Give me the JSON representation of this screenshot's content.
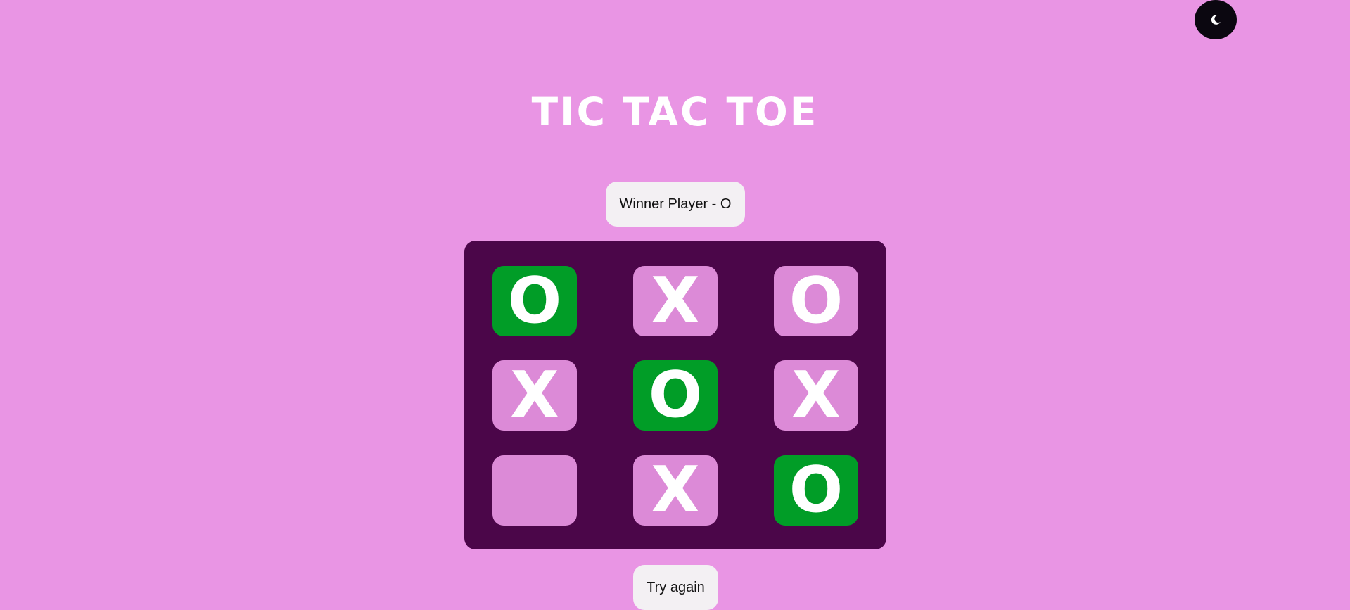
{
  "header": {
    "title": "TIC TAC TOE"
  },
  "theme_toggle": {
    "icon": "moon-icon"
  },
  "status": {
    "text": "Winner Player - O"
  },
  "board": {
    "cells": [
      {
        "value": "O",
        "winning": true
      },
      {
        "value": "X",
        "winning": false
      },
      {
        "value": "O",
        "winning": false
      },
      {
        "value": "X",
        "winning": false
      },
      {
        "value": "O",
        "winning": true
      },
      {
        "value": "X",
        "winning": false
      },
      {
        "value": "",
        "winning": false
      },
      {
        "value": "X",
        "winning": false
      },
      {
        "value": "O",
        "winning": true
      }
    ]
  },
  "actions": {
    "try_again_label": "Try again"
  },
  "colors": {
    "background": "#e995e4",
    "board": "#4b0649",
    "cell": "#dc8ad7",
    "winning_cell": "#019d27",
    "button": "#f3f0f3",
    "toggle": "#0b0710"
  }
}
